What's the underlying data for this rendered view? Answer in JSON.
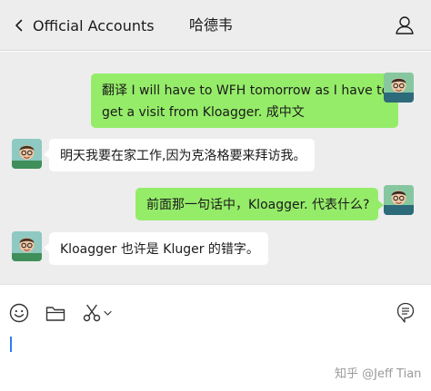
{
  "header": {
    "back_label": "Official Accounts",
    "title": "哈德韦"
  },
  "messages": [
    {
      "direction": "outgoing",
      "lines": [
        "翻译 I will have to WFH tomorrow as I have to",
        "get a visit from Kloagger. 成中文"
      ]
    },
    {
      "direction": "incoming",
      "lines": [
        "明天我要在家工作,因为克洛格要来拜访我。"
      ]
    },
    {
      "direction": "outgoing",
      "lines": [
        "前面那一句话中，Kloagger. 代表什么?"
      ]
    },
    {
      "direction": "incoming",
      "lines": [
        "Kloagger 也许是 Kluger 的错字。"
      ]
    }
  ],
  "toolbar": {
    "icons": [
      "emoji-icon",
      "folder-icon",
      "scissors-icon",
      "chevron-down-icon",
      "chat-history-icon"
    ]
  },
  "watermark": "知乎 @Jeff Tian",
  "colors": {
    "outgoing_bubble": "#95ec69",
    "incoming_bubble": "#ffffff",
    "chat_background": "#ededed",
    "caret": "#2f7df6"
  }
}
